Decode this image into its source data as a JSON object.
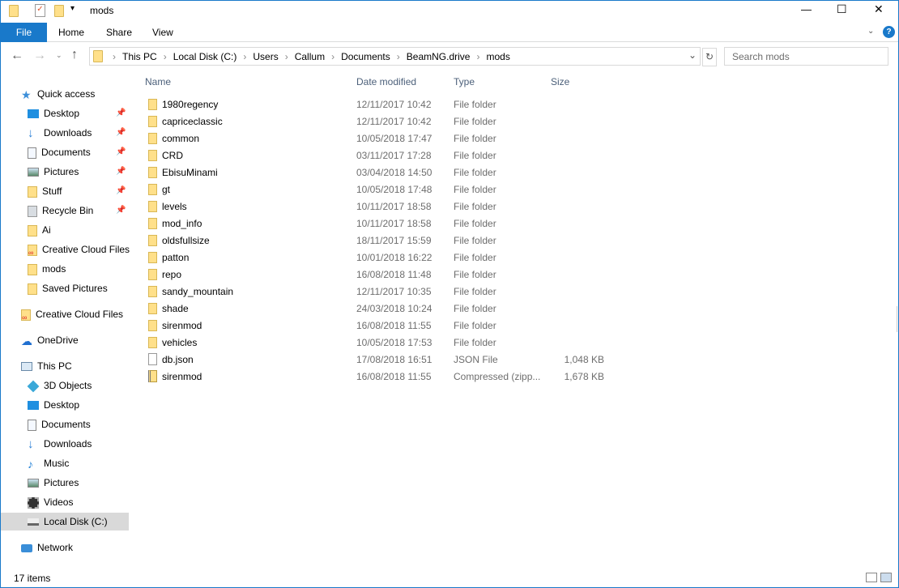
{
  "window": {
    "title": "mods",
    "controls": [
      "—",
      "☐",
      "✕"
    ]
  },
  "ribbon": {
    "tabs": [
      "File",
      "Home",
      "Share",
      "View"
    ]
  },
  "address": {
    "crumbs": [
      "This PC",
      "Local Disk (C:)",
      "Users",
      "Callum",
      "Documents",
      "BeamNG.drive",
      "mods"
    ]
  },
  "search": {
    "placeholder": "Search mods"
  },
  "sidebar": {
    "items": [
      {
        "label": "Quick access",
        "icon": "star-icon",
        "indent": 0,
        "pinned": false
      },
      {
        "label": "Desktop",
        "icon": "desktop-icon",
        "indent": 1,
        "pinned": true
      },
      {
        "label": "Downloads",
        "icon": "download-icon",
        "indent": 1,
        "pinned": true
      },
      {
        "label": "Documents",
        "icon": "documents-icon",
        "indent": 1,
        "pinned": true
      },
      {
        "label": "Pictures",
        "icon": "pictures-icon",
        "indent": 1,
        "pinned": true
      },
      {
        "label": "Stuff",
        "icon": "folder-icon",
        "indent": 1,
        "pinned": true
      },
      {
        "label": "Recycle Bin",
        "icon": "recycle-bin-icon",
        "indent": 1,
        "pinned": true
      },
      {
        "label": "Ai",
        "icon": "folder-icon",
        "indent": 1,
        "pinned": false
      },
      {
        "label": "Creative Cloud Files",
        "icon": "creative-cloud-icon",
        "indent": 1,
        "pinned": false
      },
      {
        "label": "mods",
        "icon": "folder-icon",
        "indent": 1,
        "pinned": false
      },
      {
        "label": "Saved Pictures",
        "icon": "folder-icon",
        "indent": 1,
        "pinned": false
      },
      {
        "label": "Creative Cloud Files",
        "icon": "creative-cloud-icon",
        "indent": 0,
        "pinned": false,
        "gap": true
      },
      {
        "label": "OneDrive",
        "icon": "onedrive-icon",
        "indent": 0,
        "pinned": false,
        "gap": true
      },
      {
        "label": "This PC",
        "icon": "pc-icon",
        "indent": 0,
        "pinned": false,
        "gap": true
      },
      {
        "label": "3D Objects",
        "icon": "3d-objects-icon",
        "indent": 1,
        "pinned": false
      },
      {
        "label": "Desktop",
        "icon": "desktop-icon",
        "indent": 1,
        "pinned": false
      },
      {
        "label": "Documents",
        "icon": "documents-icon",
        "indent": 1,
        "pinned": false
      },
      {
        "label": "Downloads",
        "icon": "download-icon",
        "indent": 1,
        "pinned": false
      },
      {
        "label": "Music",
        "icon": "music-icon",
        "indent": 1,
        "pinned": false
      },
      {
        "label": "Pictures",
        "icon": "pictures-icon",
        "indent": 1,
        "pinned": false
      },
      {
        "label": "Videos",
        "icon": "videos-icon",
        "indent": 1,
        "pinned": false
      },
      {
        "label": "Local Disk (C:)",
        "icon": "drive-icon",
        "indent": 1,
        "pinned": false,
        "selected": true
      },
      {
        "label": "Network",
        "icon": "network-icon",
        "indent": 0,
        "pinned": false,
        "gap": true
      }
    ]
  },
  "columns": [
    "Name",
    "Date modified",
    "Type",
    "Size"
  ],
  "files": [
    [
      "1980regency",
      "12/11/2017 10:42",
      "File folder",
      ""
    ],
    [
      "capriceclassic",
      "12/11/2017 10:42",
      "File folder",
      ""
    ],
    [
      "common",
      "10/05/2018 17:47",
      "File folder",
      ""
    ],
    [
      "CRD",
      "03/11/2017 17:28",
      "File folder",
      ""
    ],
    [
      "EbisuMinami",
      "03/04/2018 14:50",
      "File folder",
      ""
    ],
    [
      "gt",
      "10/05/2018 17:48",
      "File folder",
      ""
    ],
    [
      "levels",
      "10/11/2017 18:58",
      "File folder",
      ""
    ],
    [
      "mod_info",
      "10/11/2017 18:58",
      "File folder",
      ""
    ],
    [
      "oldsfullsize",
      "18/11/2017 15:59",
      "File folder",
      ""
    ],
    [
      "patton",
      "10/01/2018 16:22",
      "File folder",
      ""
    ],
    [
      "repo",
      "16/08/2018 11:48",
      "File folder",
      ""
    ],
    [
      "sandy_mountain",
      "12/11/2017 10:35",
      "File folder",
      ""
    ],
    [
      "shade",
      "24/03/2018 10:24",
      "File folder",
      ""
    ],
    [
      "sirenmod",
      "16/08/2018 11:55",
      "File folder",
      ""
    ],
    [
      "vehicles",
      "10/05/2018 17:53",
      "File folder",
      ""
    ],
    [
      "db.json",
      "17/08/2018 16:51",
      "JSON File",
      "1,048 KB"
    ],
    [
      "sirenmod",
      "16/08/2018 11:55",
      "Compressed (zipp...",
      "1,678 KB"
    ]
  ],
  "status": {
    "count": "17 items"
  }
}
